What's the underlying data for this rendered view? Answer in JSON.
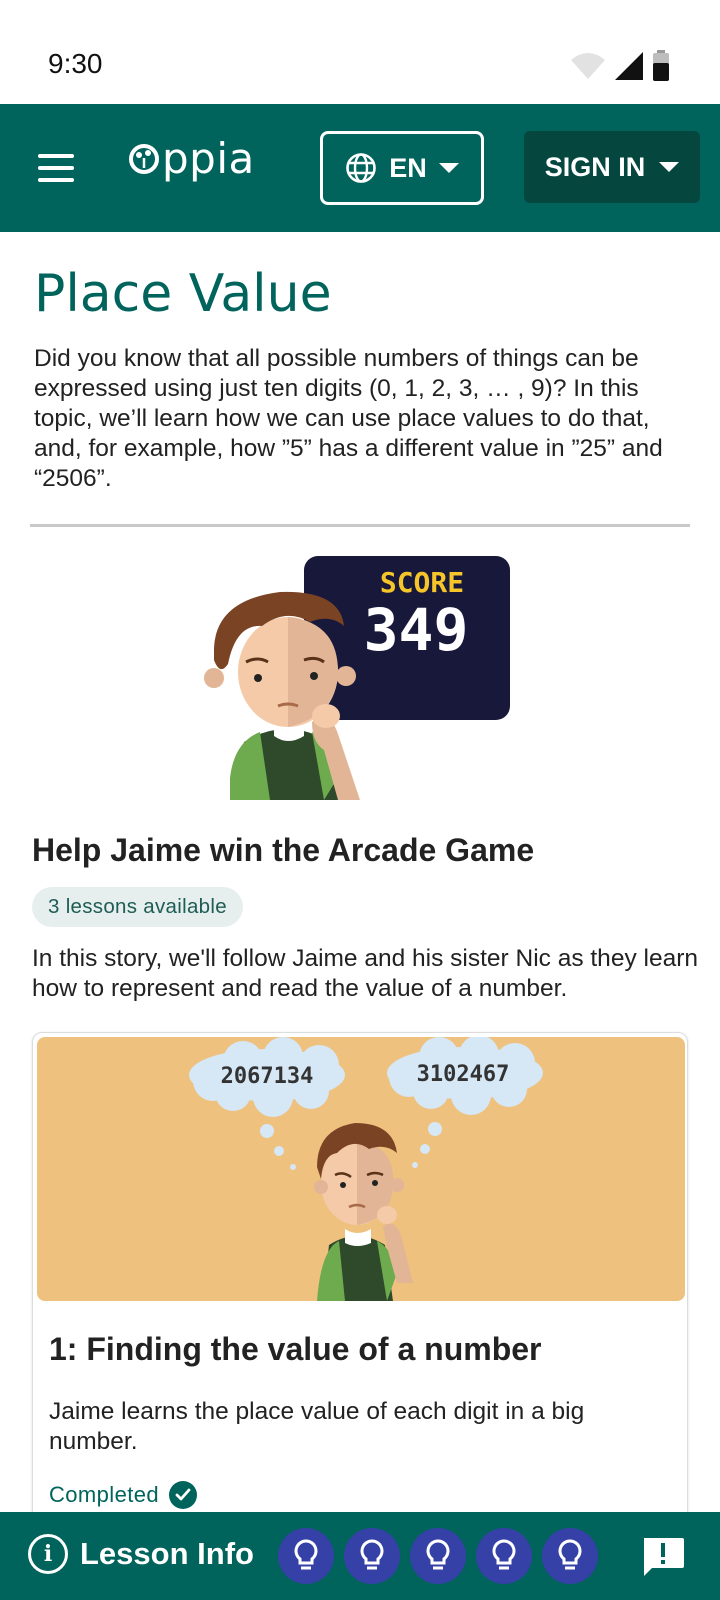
{
  "status_bar": {
    "time": "9:30"
  },
  "app_bar": {
    "logo_text": "ppia",
    "language_label": "EN",
    "sign_in_label": "SIGN IN"
  },
  "topic": {
    "title": "Place Value",
    "description": "Did you know that all possible numbers of things can be expressed using just ten digits (0, 1, 2, 3, … , 9)? In this topic, we’ll learn how we can use place values to do that, and, for example, how ”5” has a different value in ”25” and “2506”."
  },
  "story": {
    "illustration": {
      "score_label": "SCORE",
      "score_value": "349"
    },
    "title": "Help Jaime win the Arcade Game",
    "lessons_badge": "3 lessons available",
    "description": "In this story, we'll follow Jaime and his sister Nic as they learn how to represent and read the value of a number."
  },
  "lesson_card": {
    "thought_bubbles": [
      "2067134",
      "3102467"
    ],
    "title": "1: Finding the value of a number",
    "description": "Jaime learns the place value of each digit in a big number.",
    "status": "Completed"
  },
  "bottom_bar": {
    "lesson_info_label": "Lesson Info",
    "hint_count": 5,
    "feedback_icon": "exclamation-speech-bubble-icon"
  },
  "colors": {
    "primary": "#00645c",
    "primary_dark": "#05473f",
    "hint_blue": "#3541a6",
    "card_image_bg": "#eec17f",
    "score_board": "#18183a",
    "score_label": "#f6c52a"
  }
}
